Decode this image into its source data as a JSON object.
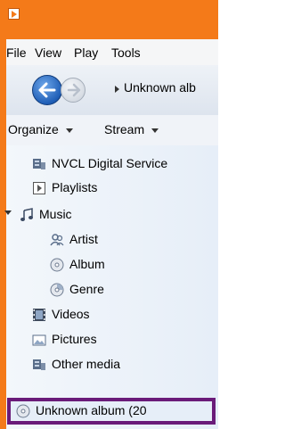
{
  "menu": {
    "items": [
      {
        "label": "File"
      },
      {
        "label": "View"
      },
      {
        "label": "Play"
      },
      {
        "label": "Tools"
      }
    ]
  },
  "navigation": {
    "breadcrumb": "Unknown alb"
  },
  "toolbar": {
    "organize_label": "Organize",
    "stream_label": "Stream"
  },
  "library_tree": {
    "nodes": [
      {
        "label": "NVCL Digital Service",
        "icon": "media-server-icon"
      },
      {
        "label": "Playlists",
        "icon": "playlist-icon"
      },
      {
        "label": "Music",
        "icon": "music-note-icon"
      },
      {
        "label": "Artist",
        "icon": "artist-icon"
      },
      {
        "label": "Album",
        "icon": "album-icon"
      },
      {
        "label": "Genre",
        "icon": "genre-icon"
      },
      {
        "label": "Videos",
        "icon": "video-icon"
      },
      {
        "label": "Pictures",
        "icon": "picture-icon"
      },
      {
        "label": "Other media",
        "icon": "other-media-icon"
      },
      {
        "label": "Unknown album (20",
        "icon": "album-icon"
      }
    ]
  },
  "colors": {
    "title_bar": "#f47a19",
    "selection_border": "#6a1b79"
  }
}
